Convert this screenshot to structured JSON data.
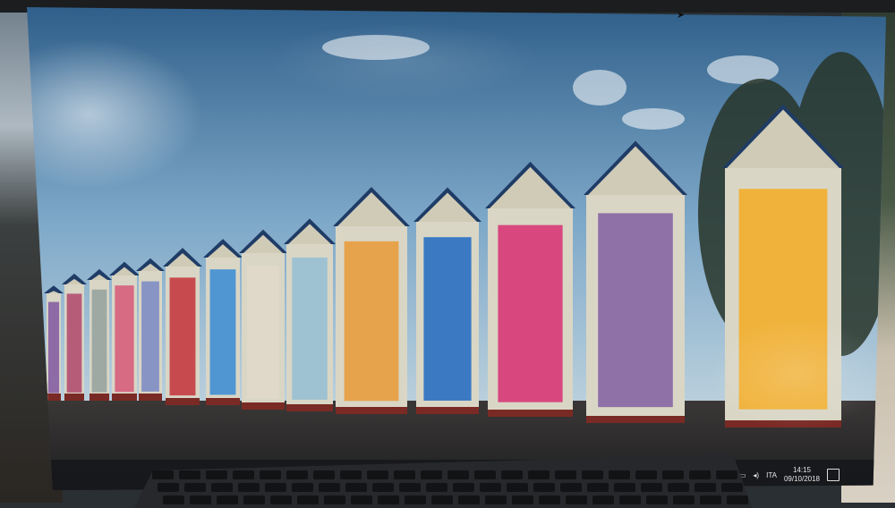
{
  "desktop": {
    "wallpaper_subject": "",
    "taskbar": {
      "items": [
        {
          "icon": "windows-start-icon",
          "glyph": "⊞",
          "active": false
        },
        {
          "icon": "folder-icon",
          "glyph": "▬",
          "active": false
        },
        {
          "icon": "store-icon",
          "glyph": "▣",
          "active": false
        },
        {
          "icon": "mail-icon",
          "glyph": "✉",
          "active": false
        },
        {
          "icon": "photos-icon",
          "glyph": "▲",
          "active": true
        }
      ],
      "tray": {
        "language": "ITA",
        "time": "14:15",
        "date": "09/10/2018"
      }
    }
  },
  "colors": {
    "sky_top": "#3f6f98",
    "sky_bottom": "#9fc3dc",
    "roof": "#1f3c66",
    "ground": "#2b2a2c",
    "huts": [
      "#8e6aa6",
      "#b75c78",
      "#9ea9a3",
      "#d86b84",
      "#8894c4",
      "#c74b4e",
      "#4f96d3",
      "#e0d8c8",
      "#9ec2d2",
      "#e7a24c",
      "#3b79c3",
      "#d8487f",
      "#8f70a7",
      "#f0b23a"
    ]
  }
}
